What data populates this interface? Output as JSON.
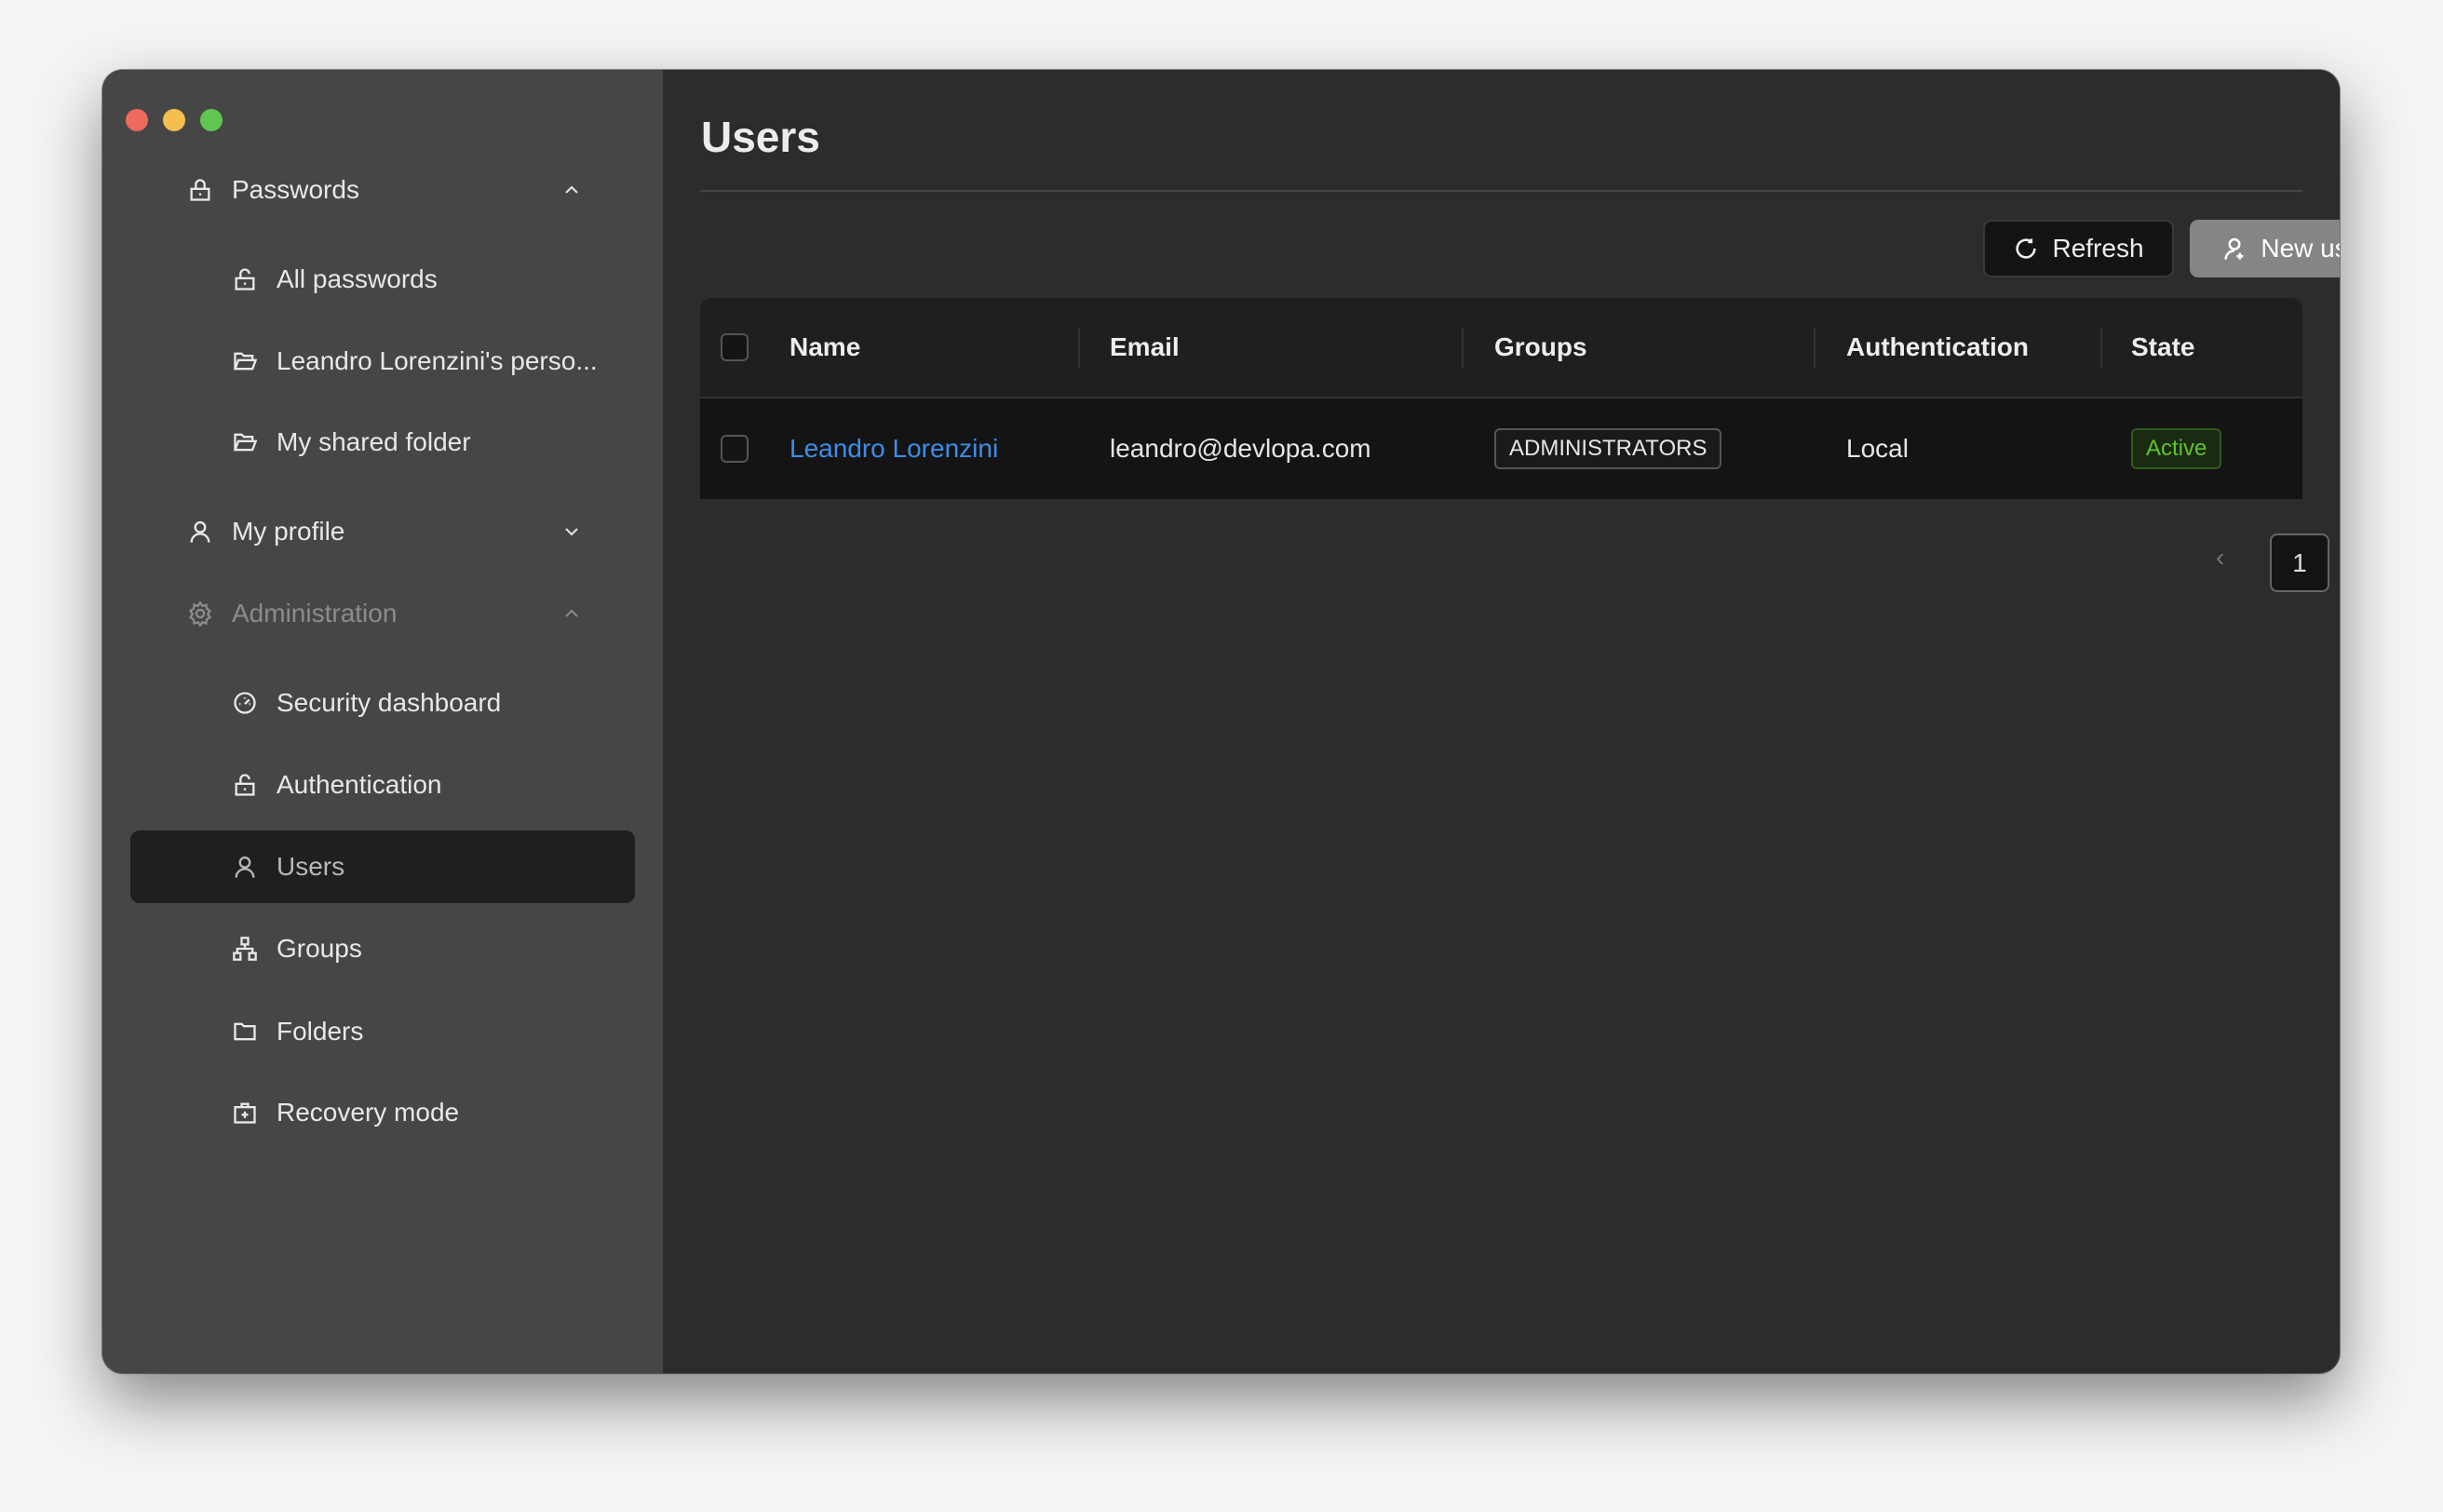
{
  "window": {
    "controls": {
      "close": "#ed6a5e",
      "minimize": "#f5bf4f",
      "zoom": "#61c554"
    }
  },
  "sidebar": {
    "items": [
      {
        "label": "Passwords",
        "icon": "lock-icon",
        "level": 1,
        "expanded": true
      },
      {
        "label": "All passwords",
        "icon": "unlock-icon",
        "level": 2
      },
      {
        "label": "Leandro Lorenzini's perso...",
        "icon": "folder-open-icon",
        "level": 2
      },
      {
        "label": "My shared folder",
        "icon": "folder-open-icon",
        "level": 2
      },
      {
        "label": "My profile",
        "icon": "user-icon",
        "level": 1,
        "expanded": false
      },
      {
        "label": "Administration",
        "icon": "gear-icon",
        "level": 1,
        "expanded": true
      },
      {
        "label": "Security dashboard",
        "icon": "dashboard-icon",
        "level": 2
      },
      {
        "label": "Authentication",
        "icon": "unlock-icon",
        "level": 2
      },
      {
        "label": "Users",
        "icon": "user-icon",
        "level": 2,
        "selected": true
      },
      {
        "label": "Groups",
        "icon": "cluster-icon",
        "level": 2
      },
      {
        "label": "Folders",
        "icon": "folder-icon",
        "level": 2
      },
      {
        "label": "Recovery mode",
        "icon": "medkit-icon",
        "level": 2
      }
    ]
  },
  "header": {
    "title": "Users"
  },
  "toolbar": {
    "refresh_label": "Refresh",
    "new_user_label": "New user"
  },
  "table": {
    "columns": [
      "Name",
      "Email",
      "Groups",
      "Authentication",
      "State"
    ],
    "rows": [
      {
        "name": "Leandro Lorenzini",
        "email": "leandro@devlopa.com",
        "groups": "ADMINISTRATORS",
        "authentication": "Local",
        "state": "Active"
      }
    ]
  },
  "pagination": {
    "current": "1"
  },
  "colors": {
    "link": "#3b8eea",
    "active": "#5fc42b"
  }
}
